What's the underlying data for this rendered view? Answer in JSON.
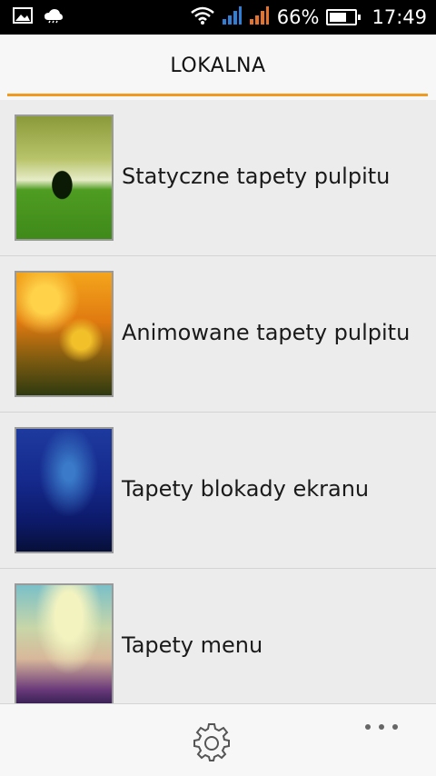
{
  "status_bar": {
    "battery_percent": "66%",
    "battery_level": 0.66,
    "time": "17:49",
    "icons": [
      "gallery-icon",
      "cloud-icon",
      "wifi-icon",
      "signal-icon",
      "signal-icon-2",
      "battery-icon"
    ]
  },
  "header": {
    "tab_title": "LOKALNA",
    "accent_color": "#f09a1f"
  },
  "list": {
    "items": [
      {
        "label": "Statyczne tapety pulpitu"
      },
      {
        "label": "Animowane tapety pulpitu"
      },
      {
        "label": "Tapety blokady ekranu"
      },
      {
        "label": "Tapety menu"
      }
    ]
  },
  "bottom_bar": {
    "icons": [
      "settings-icon",
      "more-icon"
    ]
  }
}
